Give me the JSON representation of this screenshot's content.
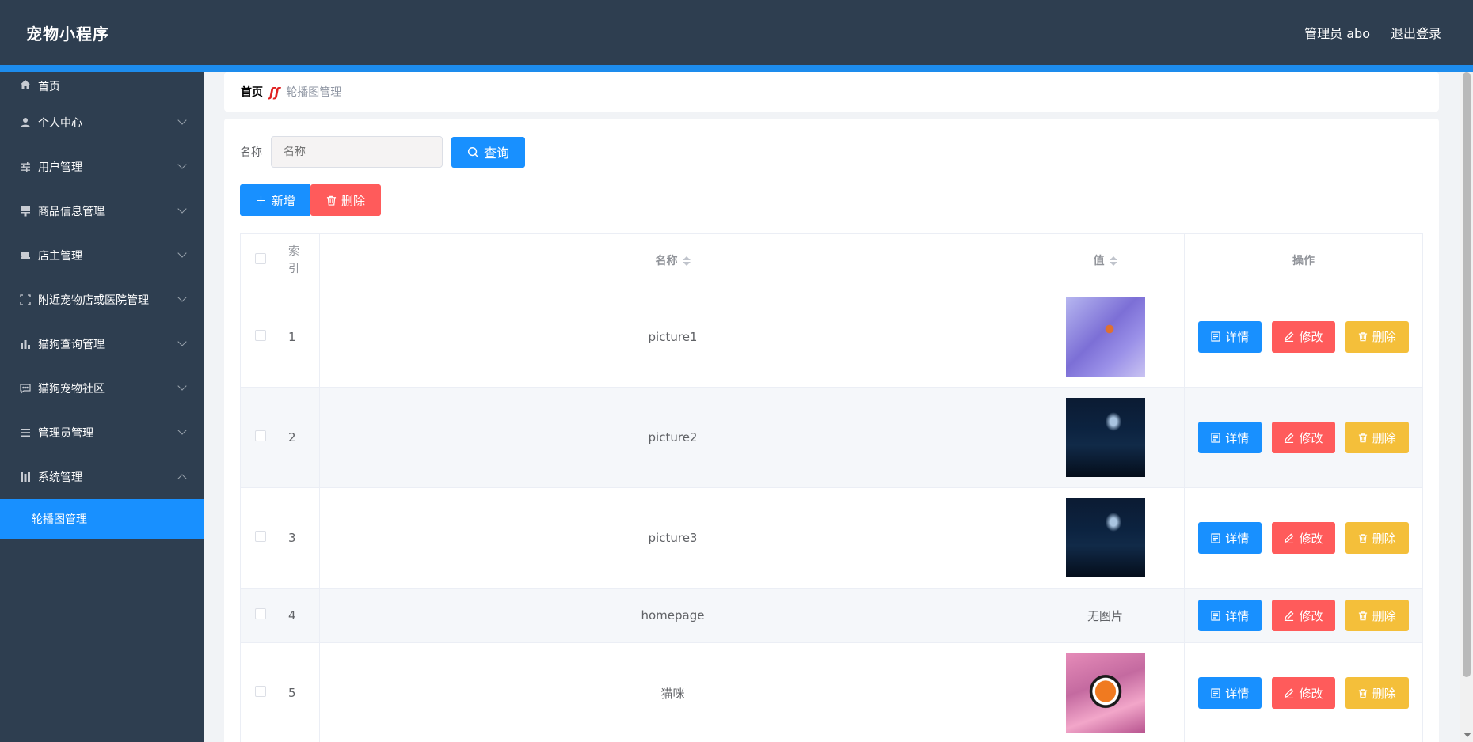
{
  "header": {
    "brand": "宠物小程序",
    "user": "管理员 abo",
    "logout": "退出登录"
  },
  "sidebar": {
    "items": [
      {
        "label": "首页",
        "icon": "home-icon",
        "expandable": false
      },
      {
        "label": "个人中心",
        "icon": "user-icon",
        "expandable": true
      },
      {
        "label": "用户管理",
        "icon": "sliders-icon",
        "expandable": true
      },
      {
        "label": "商品信息管理",
        "icon": "stamp-icon",
        "expandable": true
      },
      {
        "label": "店主管理",
        "icon": "printer-icon",
        "expandable": true
      },
      {
        "label": "附近宠物店或医院管理",
        "icon": "scan-icon",
        "expandable": true
      },
      {
        "label": "猫狗查询管理",
        "icon": "bar-chart-icon",
        "expandable": true
      },
      {
        "label": "猫狗宠物社区",
        "icon": "chat-icon",
        "expandable": true
      },
      {
        "label": "管理员管理",
        "icon": "list-icon",
        "expandable": true
      },
      {
        "label": "系统管理",
        "icon": "columns-icon",
        "expandable": true,
        "expanded": true
      }
    ],
    "sub_item": "轮播图管理"
  },
  "breadcrumb": {
    "home": "首页",
    "current": "轮播图管理"
  },
  "search": {
    "label": "名称",
    "placeholder": "名称",
    "button": "查询"
  },
  "actions": {
    "add": "新增",
    "delete": "删除"
  },
  "table": {
    "headers": {
      "index": "索引",
      "name": "名称",
      "value": "值",
      "ops": "操作"
    },
    "rows": [
      {
        "index": "1",
        "name": "picture1",
        "image": "purple",
        "no_image_text": ""
      },
      {
        "index": "2",
        "name": "picture2",
        "image": "dark",
        "no_image_text": ""
      },
      {
        "index": "3",
        "name": "picture3",
        "image": "dark",
        "no_image_text": ""
      },
      {
        "index": "4",
        "name": "homepage",
        "image": "",
        "no_image_text": "无图片"
      },
      {
        "index": "5",
        "name": "猫咪",
        "image": "fish",
        "no_image_text": ""
      }
    ],
    "op_labels": {
      "detail": "详情",
      "edit": "修改",
      "delete": "删除"
    }
  },
  "colors": {
    "header_bg": "#2e3e50",
    "accent": "#1890ff",
    "danger": "#ff5b5b",
    "warning": "#f4bf3a"
  }
}
